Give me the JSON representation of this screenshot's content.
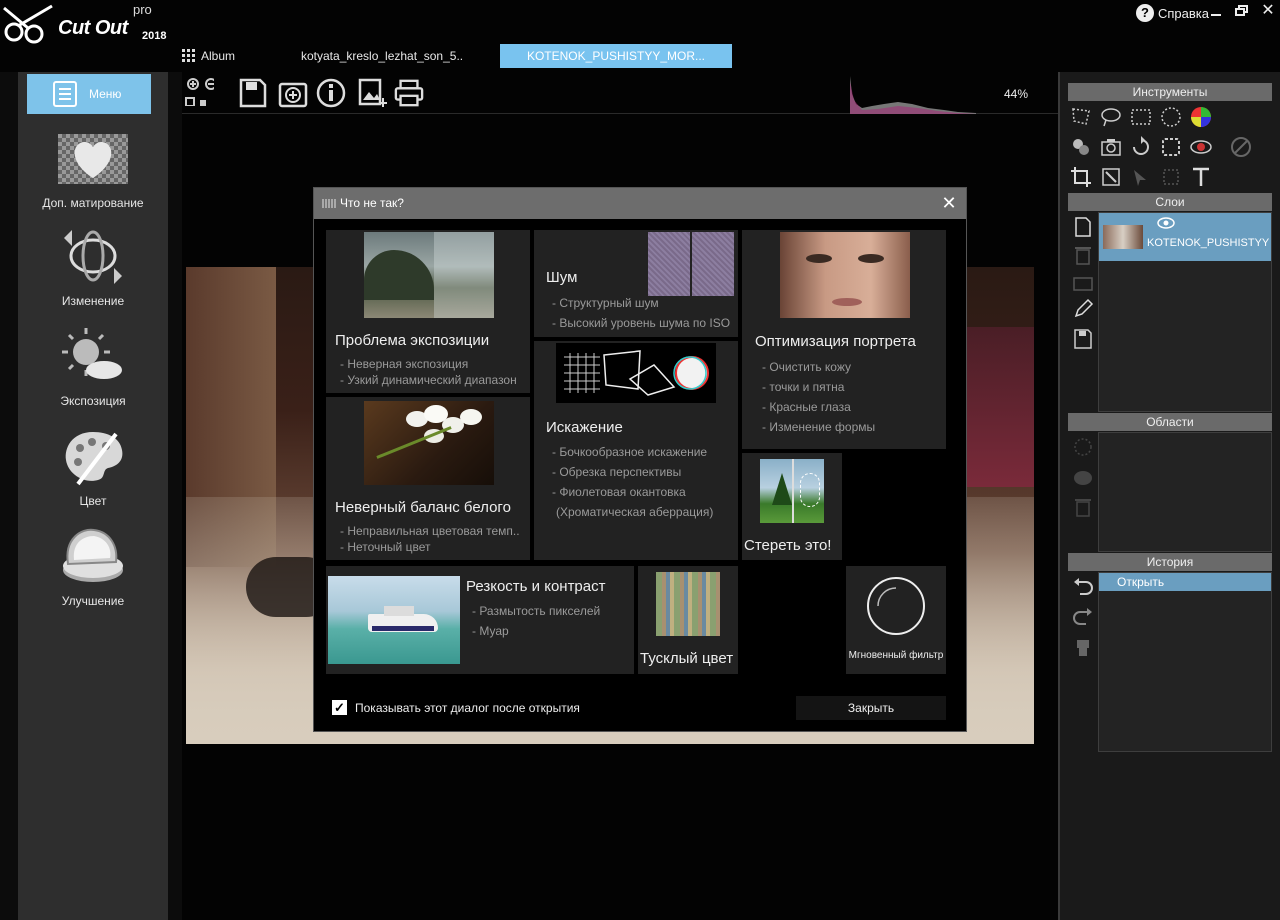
{
  "app": {
    "logo_text": "Cut Out",
    "logo_pro": "pro",
    "logo_year": "2018"
  },
  "header": {
    "help_label": "Справка"
  },
  "tabs": [
    {
      "label": "Album"
    },
    {
      "label": "kotyata_kreslo_lezhat_son_5.."
    },
    {
      "label": "KOTENOK_PUSHISTYY_MOR..."
    }
  ],
  "toolbar": {
    "zoom": "44%"
  },
  "sidebar": {
    "menu_label": "Меню",
    "items": [
      {
        "label": "Доп. матирование",
        "icon": "heart-matte-icon"
      },
      {
        "label": "Изменение",
        "icon": "transform-icon"
      },
      {
        "label": "Экспозиция",
        "icon": "exposure-sun-icon"
      },
      {
        "label": "Цвет",
        "icon": "palette-icon"
      },
      {
        "label": "Улучшение",
        "icon": "compact-mirror-icon"
      }
    ]
  },
  "right_panel": {
    "tools_title": "Инструменты",
    "layers_title": "Слои",
    "layer_name": "KOTENOK_PUSHISTYY",
    "regions_title": "Области",
    "history_title": "История",
    "history_items": [
      "Открыть"
    ]
  },
  "dialog": {
    "title": "Что не так?",
    "cards": [
      {
        "title": "Проблема экспозиции",
        "lines": [
          "- Неверная экспозиция",
          "- Узкий динамический диапазон"
        ]
      },
      {
        "title": "Шум",
        "lines": [
          "- Структурный шум",
          "- Высокий уровень шума по ISO"
        ]
      },
      {
        "title": "Оптимизация портрета",
        "lines": [
          "- Очистить кожу",
          "- точки и пятна",
          "- Красные глаза",
          "- Изменение формы"
        ]
      },
      {
        "title": "Искажение",
        "lines": [
          "- Бочкообразное искажение",
          "- Обрезка перспективы",
          "- Фиолетовая окантовка",
          "(Хроматическая аберрация)"
        ]
      },
      {
        "title": "Неверный баланс белого",
        "lines": [
          "- Неправильная цветовая темп..",
          "- Неточный цвет"
        ]
      },
      {
        "title": "Стереть это!",
        "lines": []
      },
      {
        "title": "Резкость и контраст",
        "lines": [
          "- Размытость пикселей",
          "- Муар"
        ]
      },
      {
        "title": "Тусклый цвет",
        "lines": []
      },
      {
        "title": "Мгновенный фильтр",
        "lines": []
      }
    ],
    "show_checkbox_label": "Показывать этот диалог после открытия",
    "show_checkbox_checked": true,
    "close_label": "Закрыть"
  },
  "colors": {
    "accent": "#79c3ef",
    "dialog_title_bg": "#6d6d6d",
    "card_bg": "#222222"
  }
}
